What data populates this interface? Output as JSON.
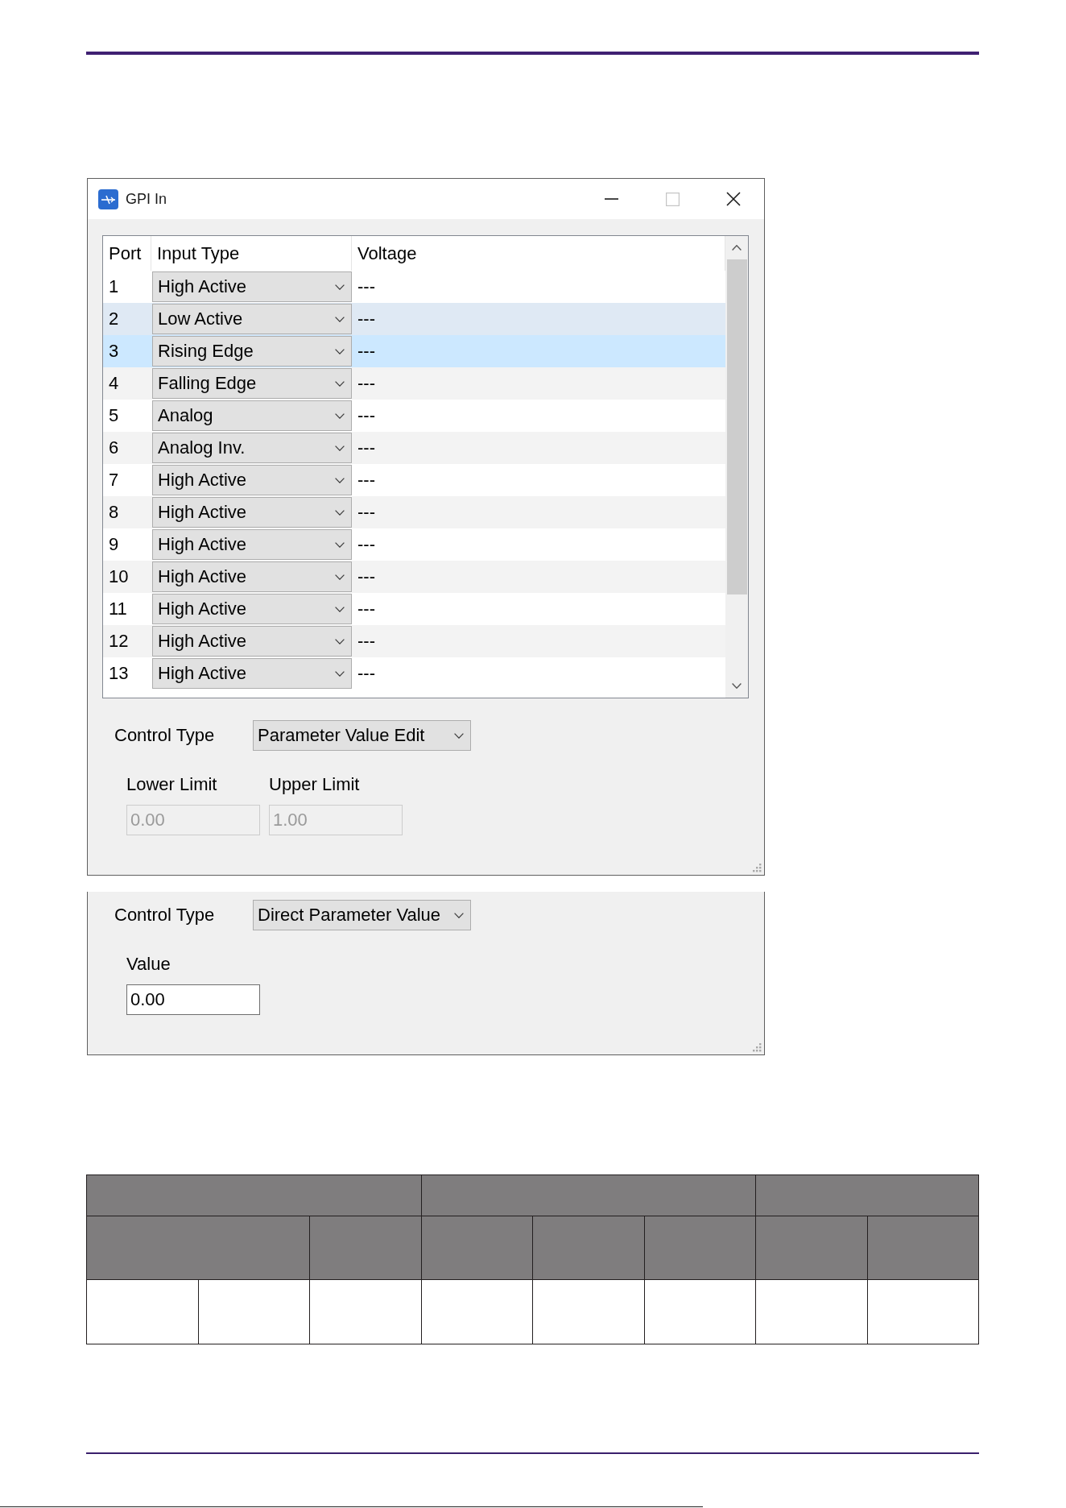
{
  "window": {
    "title": "GPI In",
    "title_buttons": [
      {
        "kind": "minimize",
        "disabled": false
      },
      {
        "kind": "maximize",
        "disabled": true
      },
      {
        "kind": "close",
        "disabled": false
      }
    ],
    "port_table": {
      "columns": [
        "Port",
        "Input Type",
        "Voltage"
      ],
      "rows": [
        {
          "port": "1",
          "input_type": "High Active",
          "voltage": "---",
          "selected": false,
          "hovered": false
        },
        {
          "port": "2",
          "input_type": "Low Active",
          "voltage": "---",
          "selected": false,
          "hovered": true
        },
        {
          "port": "3",
          "input_type": "Rising Edge",
          "voltage": "---",
          "selected": true,
          "hovered": false
        },
        {
          "port": "4",
          "input_type": "Falling Edge",
          "voltage": "---",
          "selected": false,
          "hovered": false
        },
        {
          "port": "5",
          "input_type": "Analog",
          "voltage": "---",
          "selected": false,
          "hovered": false
        },
        {
          "port": "6",
          "input_type": "Analog Inv.",
          "voltage": "---",
          "selected": false,
          "hovered": false
        },
        {
          "port": "7",
          "input_type": "High Active",
          "voltage": "---",
          "selected": false,
          "hovered": false
        },
        {
          "port": "8",
          "input_type": "High Active",
          "voltage": "---",
          "selected": false,
          "hovered": false
        },
        {
          "port": "9",
          "input_type": "High Active",
          "voltage": "---",
          "selected": false,
          "hovered": false
        },
        {
          "port": "10",
          "input_type": "High Active",
          "voltage": "---",
          "selected": false,
          "hovered": false
        },
        {
          "port": "11",
          "input_type": "High Active",
          "voltage": "---",
          "selected": false,
          "hovered": false
        },
        {
          "port": "12",
          "input_type": "High Active",
          "voltage": "---",
          "selected": false,
          "hovered": false
        },
        {
          "port": "13",
          "input_type": "High Active",
          "voltage": "---",
          "selected": false,
          "hovered": false
        }
      ]
    },
    "settings": {
      "control_type_label": "Control Type",
      "control_type": "Parameter Value Edit",
      "fields": [
        {
          "label": "Lower Limit",
          "value": "0.00",
          "disabled": true
        },
        {
          "label": "Upper Limit",
          "value": "1.00",
          "disabled": true
        }
      ]
    }
  },
  "settings_panel": {
    "control_type_label": "Control Type",
    "control_type": "Direct Parameter Value",
    "fields": [
      {
        "label": "Value",
        "value": "0.00",
        "disabled": false
      }
    ]
  },
  "blank_table": {
    "groups": [
      {
        "columns": [
          {
            "kind": "double"
          },
          {
            "kind": "single"
          }
        ]
      },
      {
        "columns": [
          {
            "kind": "single"
          },
          {
            "kind": "single"
          },
          {
            "kind": "single"
          }
        ]
      },
      {
        "columns": [
          {
            "kind": "single"
          },
          {
            "kind": "single"
          }
        ]
      }
    ],
    "rows": [
      {
        "kind": "blank"
      }
    ]
  }
}
